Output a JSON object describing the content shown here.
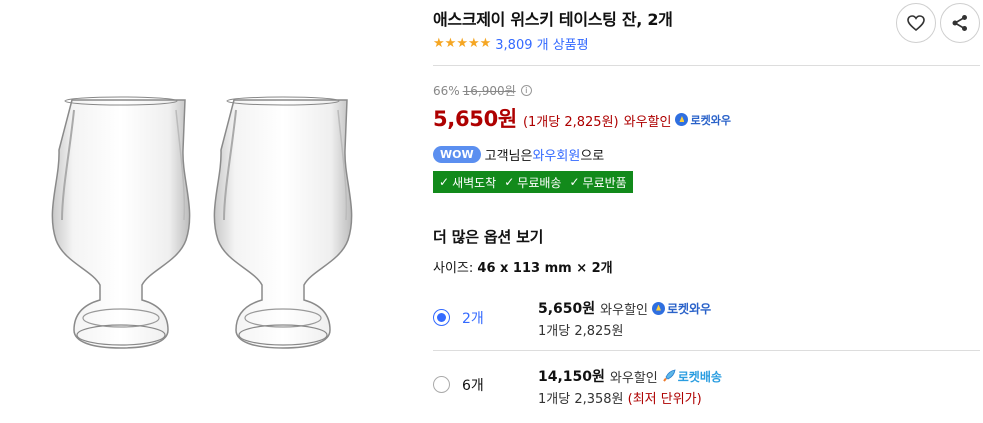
{
  "product": {
    "title": "애스크제이 위스키 테이스팅 잔, 2개",
    "rating_stars": 5,
    "review_count": "3,809 개 상품평"
  },
  "price": {
    "discount_rate": "66%",
    "original_price": "16,900원",
    "sale_price": "5,650원",
    "unit_price": "(1개당 2,825원)",
    "wow_discount": "와우할인",
    "rocket_badge": "로켓와우"
  },
  "membership": {
    "wow_pill": "WOW",
    "prefix": "고객님은",
    "member_label": "와우회원",
    "suffix": "으로"
  },
  "benefits": [
    "새벽도착",
    "무료배송",
    "무료반품"
  ],
  "options": {
    "title": "더 많은 옵션 보기",
    "size_label": "사이즈:",
    "size_value": "46 x 113 mm × 2개",
    "items": [
      {
        "label": "2개",
        "price": "5,650원",
        "wow": "와우할인",
        "badge": "로켓와우",
        "unit": "1개당 2,825원",
        "note": "",
        "selected": true
      },
      {
        "label": "6개",
        "price": "14,150원",
        "wow": "와우할인",
        "badge": "로켓배송",
        "unit": "1개당 2,358원",
        "note": "(최저 단위가)",
        "selected": false
      }
    ]
  },
  "colors": {
    "price_red": "#ae0000",
    "link_blue": "#346aff",
    "benefit_green": "#128a1b",
    "star": "#f5a623"
  }
}
